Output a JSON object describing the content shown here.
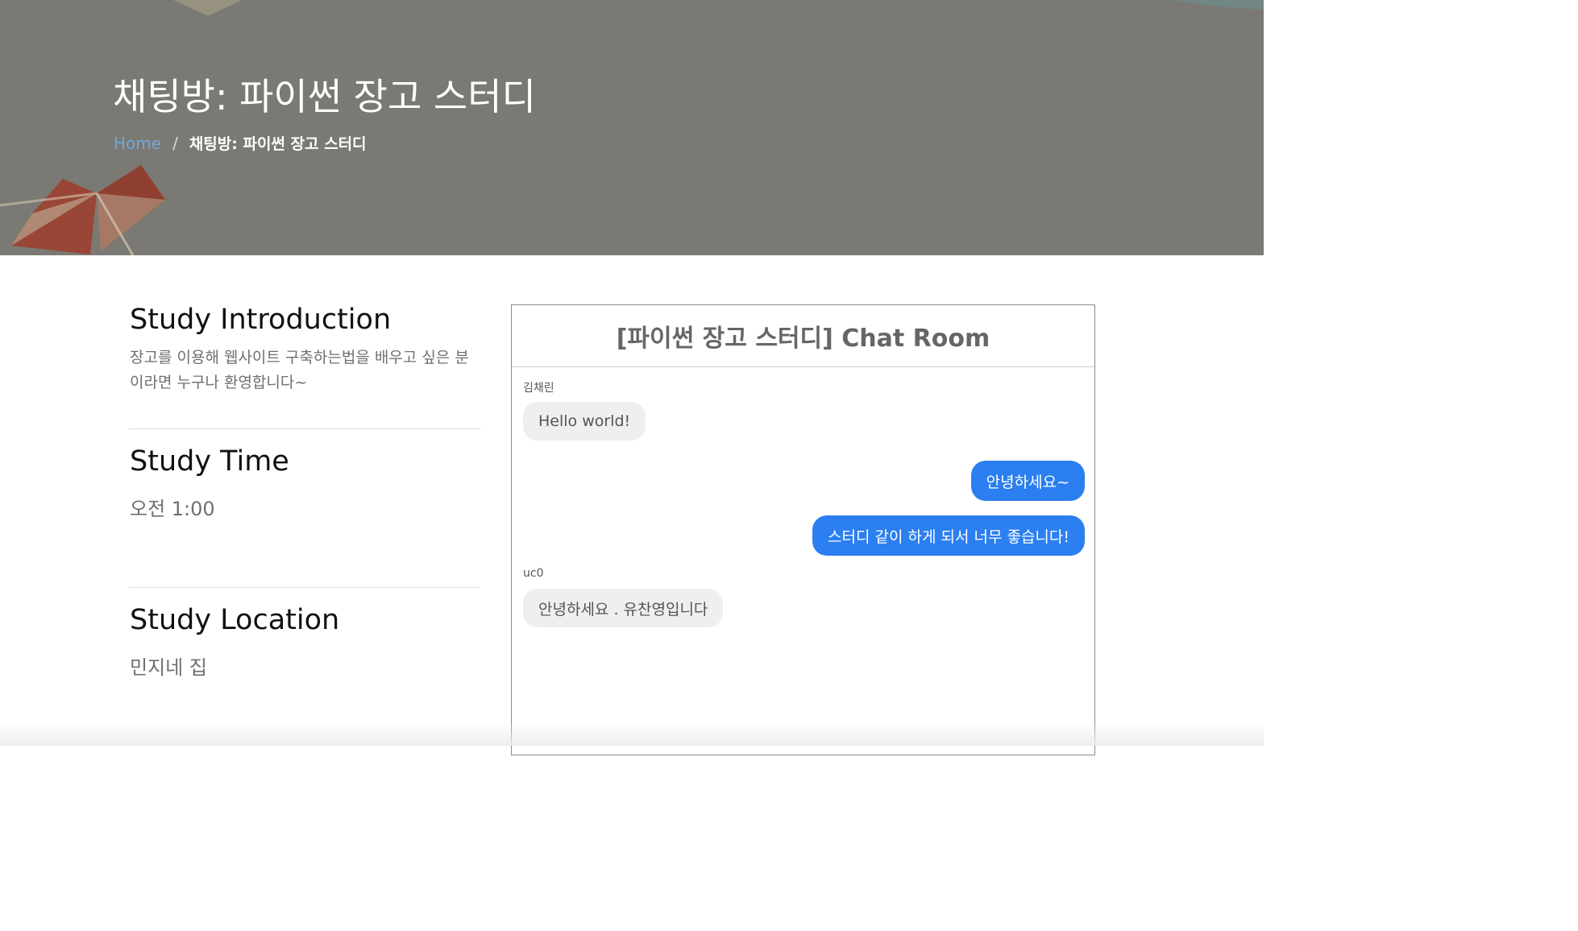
{
  "hero": {
    "title": "채팅방: 파이썬 장고 스터디",
    "breadcrumb": {
      "home": "Home",
      "separator": "/",
      "current": "채팅방: 파이썬 장고 스터디"
    }
  },
  "sections": {
    "introduction": {
      "heading": "Study Introduction",
      "text": "장고를 이용해 웹사이트 구축하는법을 배우고 싶은 분이라면 누구나 환영합니다~"
    },
    "time": {
      "heading": "Study Time",
      "value": "오전 1:00"
    },
    "location": {
      "heading": "Study Location",
      "value": "민지네 집"
    }
  },
  "chat": {
    "title": "[파이썬 장고 스터디] Chat Room",
    "messages": [
      {
        "sender": "김채린",
        "text": "Hello world!",
        "direction": "in"
      },
      {
        "sender": "",
        "text": "안녕하세요~",
        "direction": "out"
      },
      {
        "sender": "",
        "text": "스터디 같이 하게 되서 너무 좋습니다!",
        "direction": "out"
      },
      {
        "sender": "uc0",
        "text": "안녕하세요 . 유찬영입니다",
        "direction": "in"
      }
    ]
  },
  "colors": {
    "hero_bg": "#7b7973",
    "breadcrumb_link": "#6fa8dc",
    "outgoing_bubble": "#2b7ff0",
    "incoming_bubble": "#efefef"
  }
}
